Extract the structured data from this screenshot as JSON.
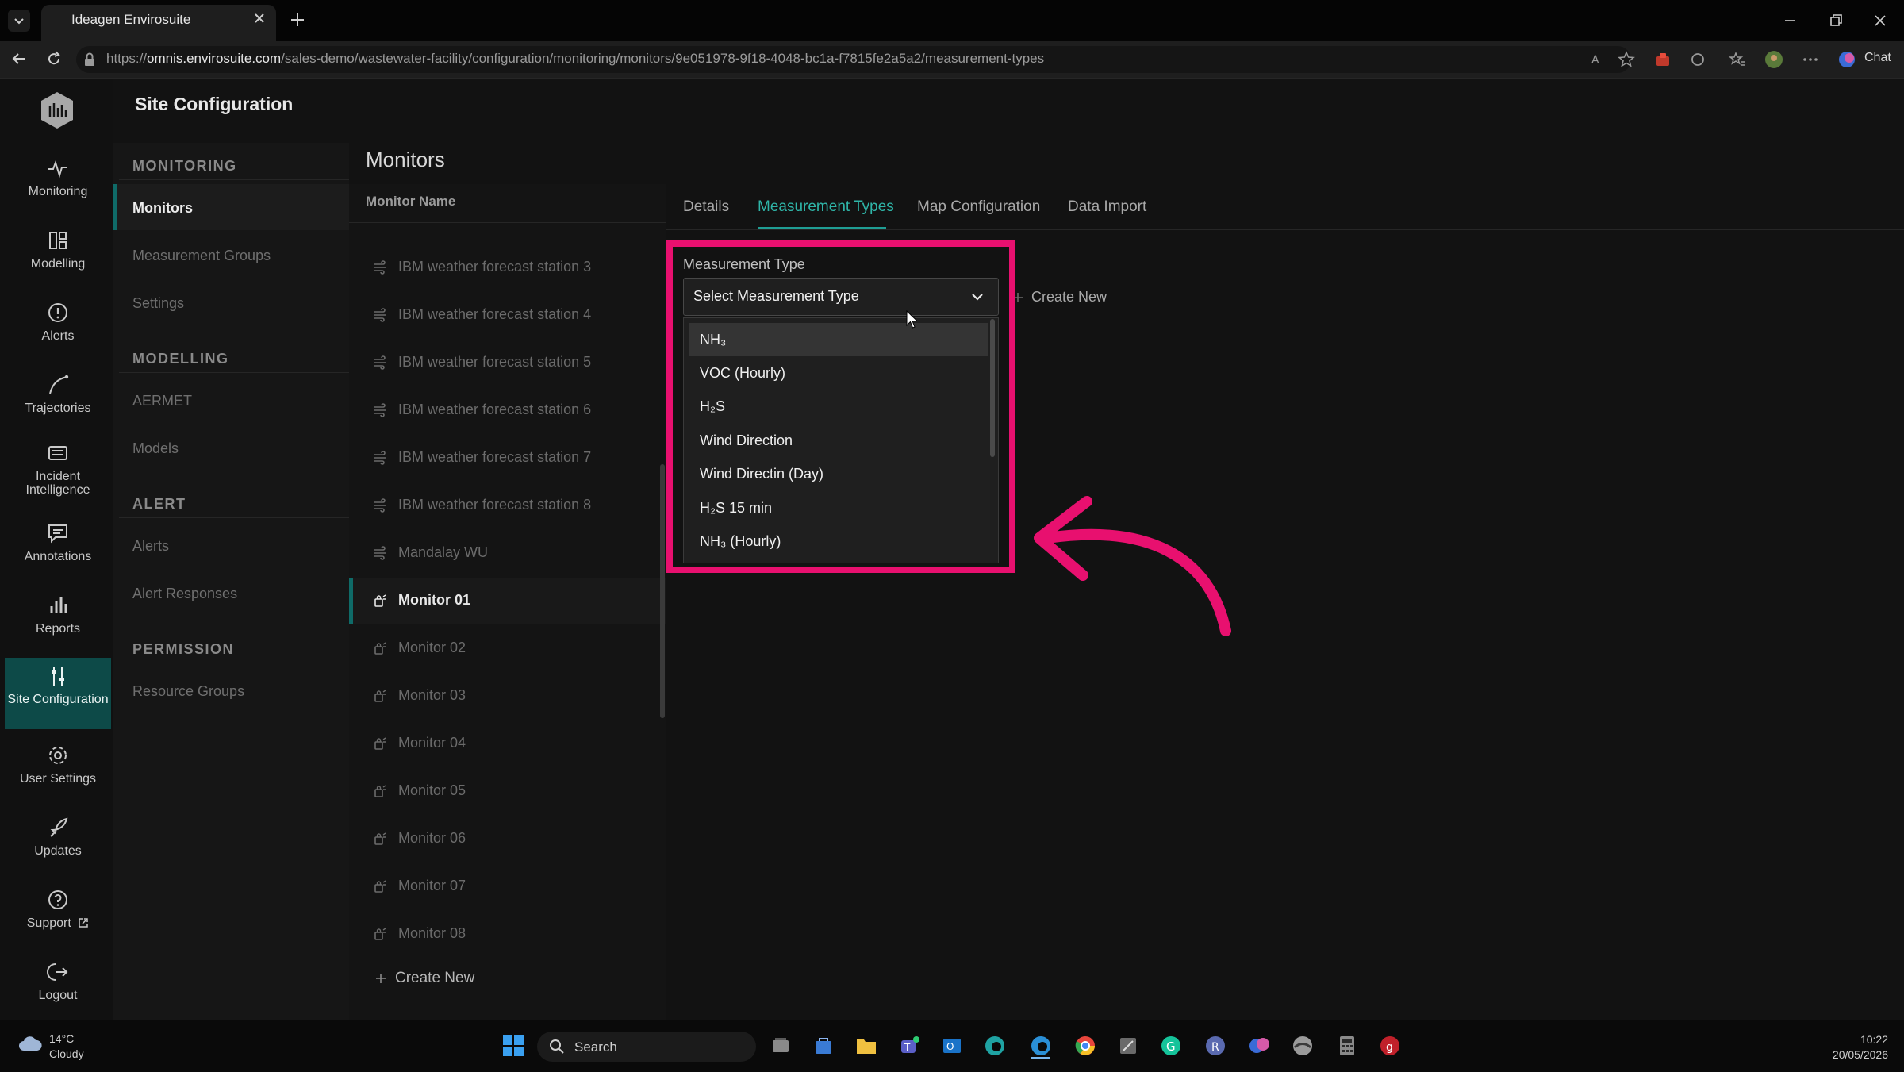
{
  "browser": {
    "tab_title": "Ideagen Envirosuite",
    "url_prefix": "https://",
    "url_domain": "omnis.envirosuite.com",
    "url_path": "/sales-demo/wastewater-facility/configuration/monitoring/monitors/9e051978-9f18-4048-bc1a-f7815fe2a5a2/measurement-types",
    "chat_label": "Chat"
  },
  "rail": {
    "items": [
      {
        "label": "Monitoring",
        "icon": "activity-icon"
      },
      {
        "label": "Modelling",
        "icon": "modelling-icon"
      },
      {
        "label": "Alerts",
        "icon": "alert-circle-icon"
      },
      {
        "label": "Trajectories",
        "icon": "trajectory-icon"
      },
      {
        "label": "Incident Intelligence",
        "icon": "incident-icon"
      },
      {
        "label": "Annotations",
        "icon": "annotation-icon"
      },
      {
        "label": "Reports",
        "icon": "bar-chart-icon"
      },
      {
        "label": "Site Configuration",
        "icon": "sliders-icon"
      },
      {
        "label": "User Settings",
        "icon": "gear-icon"
      },
      {
        "label": "Updates",
        "icon": "rocket-icon"
      },
      {
        "label": "Support",
        "icon": "help-icon"
      },
      {
        "label": "Logout",
        "icon": "logout-icon"
      }
    ]
  },
  "app_title": "Site Configuration",
  "nav": {
    "monitoring_heading": "MONITORING",
    "monitors": "Monitors",
    "measurement_groups": "Measurement Groups",
    "settings": "Settings",
    "modelling_heading": "MODELLING",
    "aermet": "AERMET",
    "models": "Models",
    "alert_heading": "ALERT",
    "alerts": "Alerts",
    "alert_responses": "Alert Responses",
    "permission_heading": "PERMISSION",
    "resource_groups": "Resource Groups"
  },
  "monitors_panel": {
    "title": "Monitors",
    "column_header": "Monitor Name",
    "rows": [
      "IBM weather forecast station 3",
      "IBM weather forecast station 4",
      "IBM weather forecast station 5",
      "IBM weather forecast station 6",
      "IBM weather forecast station 7",
      "IBM weather forecast station 8",
      "Mandalay WU",
      "Monitor 01",
      "Monitor 02",
      "Monitor 03",
      "Monitor 04",
      "Monitor 05",
      "Monitor 06",
      "Monitor 07",
      "Monitor 08"
    ],
    "create_new": "Create New"
  },
  "tabs": [
    "Details",
    "Measurement Types",
    "Map Configuration",
    "Data Import"
  ],
  "measurement": {
    "label": "Measurement Type",
    "select_value": "Select Measurement Type",
    "create_new": "Create New",
    "options": [
      "NH₃",
      "VOC (Hourly)",
      "H₂S",
      "Wind Direction",
      "Wind Directin (Day)",
      "H₂S 15 min",
      "NH₃ (Hourly)"
    ]
  },
  "taskbar": {
    "temperature": "14°C",
    "condition": "Cloudy",
    "search": "Search",
    "time": "10:22",
    "date": "20/05/2026"
  },
  "colors": {
    "accent_teal": "#2fb5a8",
    "highlight_pink": "#e8106f",
    "active_nav": "#0d4a48"
  }
}
